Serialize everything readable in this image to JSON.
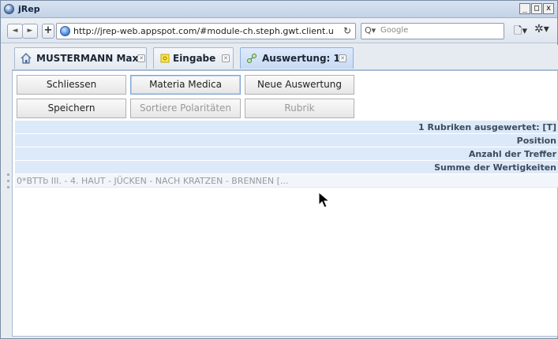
{
  "window": {
    "title": "jRep",
    "controls": [
      "_",
      "□",
      "x"
    ]
  },
  "navbar": {
    "back": "◄",
    "forward": "►",
    "new_tab": "+",
    "url": "http://jrep-web.appspot.com/#module-ch.steph.gwt.client.ui.vie",
    "search_placeholder": "Google"
  },
  "tabs": [
    {
      "label": "MUSTERMANN Max",
      "icon": "home-icon"
    },
    {
      "label": "Eingabe",
      "icon": "input-icon"
    },
    {
      "label": "Auswertung: 1",
      "icon": "evaluation-icon",
      "active": true
    }
  ],
  "toolbar": {
    "schliessen": "Schliessen",
    "materia_medica": "Materia Medica",
    "neue_auswertung": "Neue Auswertung",
    "speichern": "Speichern",
    "sortiere": "Sortiere Polaritäten",
    "rubrik": "Rubrik"
  },
  "table": {
    "headers": [
      "1 Rubriken ausgewertet: [T]",
      "Position",
      "Anzahl der Treffer",
      "Summe der Wertigkeiten"
    ],
    "rows": [
      "0*BTTb  III. - 4. HAUT - JÜCKEN - NACH KRATZEN - BRENNEN  [..."
    ]
  }
}
